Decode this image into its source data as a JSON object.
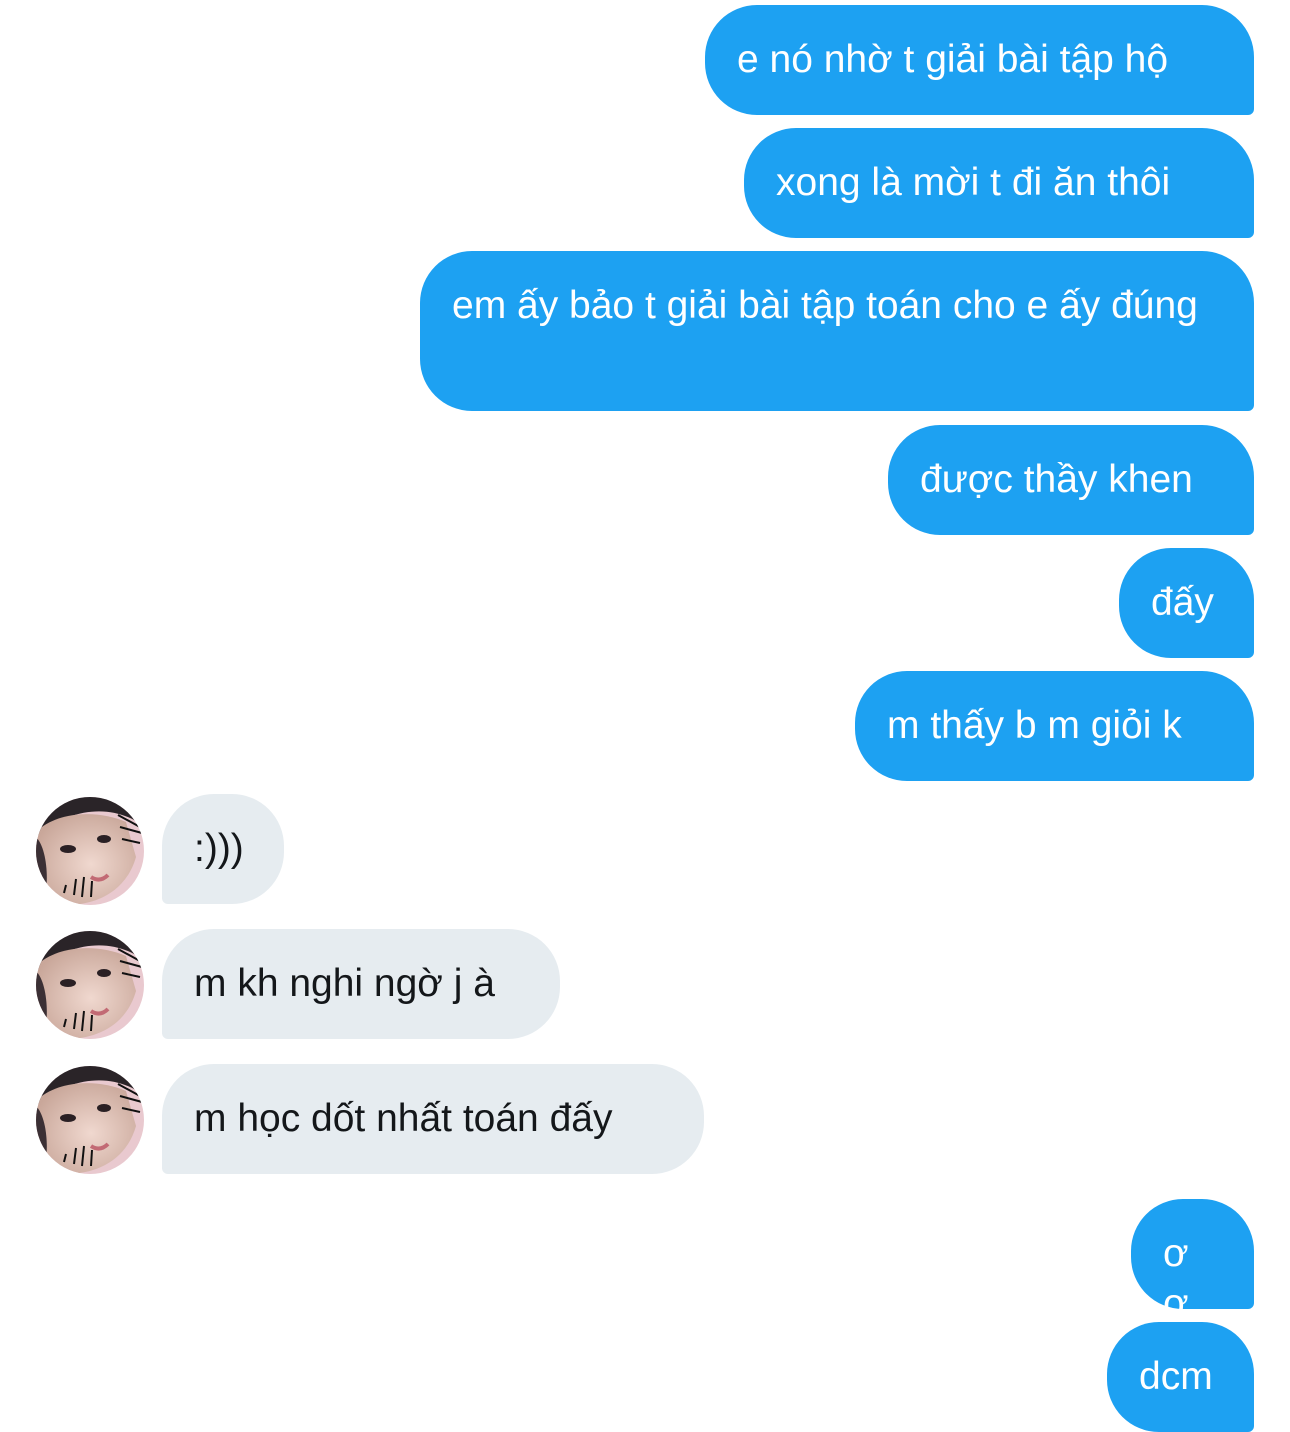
{
  "conversation": {
    "sent_1": "e nó nhờ t giải bài tập hộ",
    "sent_2": "xong là mời t đi ăn thôi",
    "sent_3": "em ấy bảo t giải bài tập toán cho e ấy đúng",
    "sent_4": "được thầy khen",
    "sent_5": "đấy",
    "sent_6": "m thấy b m giỏi k",
    "recv_1": ":)))",
    "recv_2": "m kh nghi ngờ j à",
    "recv_3": "m học dốt nhất toán đấy",
    "sent_7": "ơ ơ",
    "sent_8": "dcm"
  },
  "colors": {
    "sent_bubble": "#1da1f2",
    "received_bubble": "#e6ecf0",
    "sent_text": "#ffffff",
    "received_text": "#14171a"
  },
  "icons": {
    "avatar": "user-avatar-photo"
  }
}
